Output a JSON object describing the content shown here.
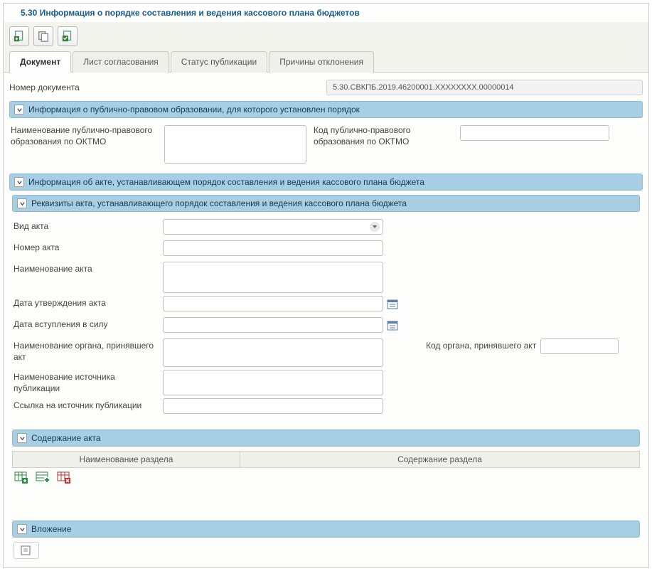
{
  "title": "5.30 Информация о порядке составления и ведения кассового плана бюджетов",
  "tabs": [
    {
      "label": "Документ",
      "active": true
    },
    {
      "label": "Лист согласования",
      "active": false
    },
    {
      "label": "Статус публикации",
      "active": false
    },
    {
      "label": "Причины отклонения",
      "active": false
    }
  ],
  "doc_number_label": "Номер документа",
  "doc_number_value": "5.30.СВКПБ.2019.46200001.XXXXXXXX.00000014",
  "sections": {
    "ppo": {
      "title": "Информация о публично-правовом образовании, для которого установлен порядок",
      "name_label": "Наименование публично-правового образования по ОКТМО",
      "code_label": "Код публично-правового образования по ОКТМО",
      "name_value": "",
      "code_value": ""
    },
    "act_info": {
      "title": "Информация об акте, устанавливающем порядок составления и ведения кассового плана бюджета"
    },
    "act_req": {
      "title": "Реквизиты акта, устанавливающего порядок составления и ведения кассового плана бюджета",
      "fields": {
        "type_label": "Вид акта",
        "type_value": "",
        "number_label": "Номер акта",
        "number_value": "",
        "name_label": "Наименование акта",
        "name_value": "",
        "approve_date_label": "Дата утверждения акта",
        "approve_date_value": "",
        "effective_date_label": "Дата вступления в силу",
        "effective_date_value": "",
        "body_name_label": "Наименование органа, принявшего акт",
        "body_name_value": "",
        "body_code_label": "Код органа, принявшего акт",
        "body_code_value": "",
        "pub_source_label": "Наименование источника публикации",
        "pub_source_value": "",
        "pub_link_label": "Ссылка на источник публикации",
        "pub_link_value": ""
      }
    },
    "act_content": {
      "title": "Содержание акта",
      "columns": [
        "Наименование раздела",
        "Содержание раздела"
      ]
    },
    "attachment": {
      "title": "Вложение"
    }
  }
}
